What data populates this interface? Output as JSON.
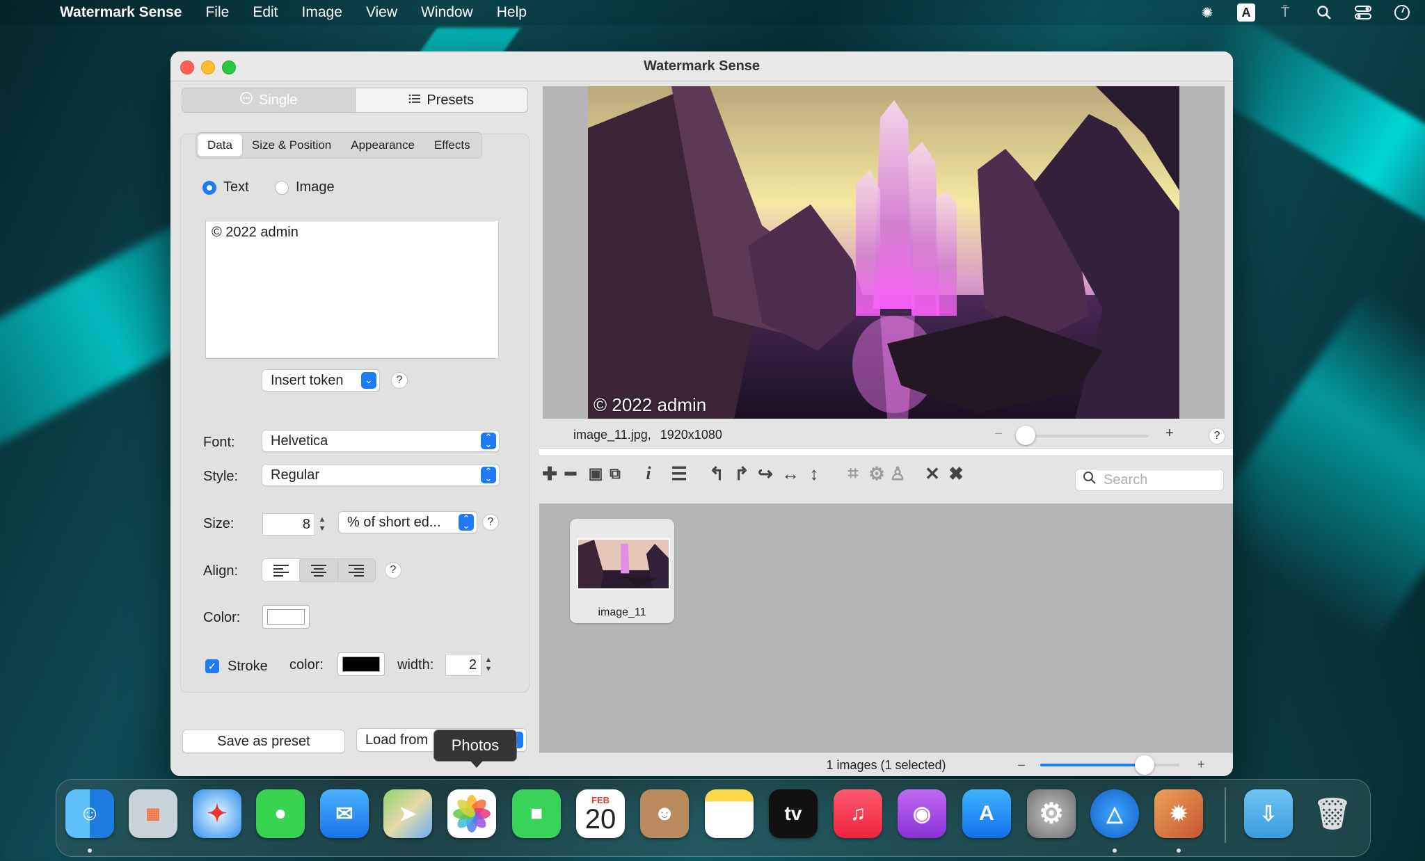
{
  "menubar": {
    "app_name": "Watermark Sense",
    "items": [
      "File",
      "Edit",
      "Image",
      "View",
      "Window",
      "Help"
    ],
    "right_icons": [
      "bug-icon",
      "input-source-icon",
      "antenna-icon",
      "spotlight-search-icon",
      "control-center-icon",
      "clock-icon"
    ],
    "input_source_letter": "A"
  },
  "window": {
    "title": "Watermark Sense",
    "mode_tabs": [
      "Single",
      "Presets"
    ],
    "settings_tabs": [
      "Data",
      "Size & Position",
      "Appearance",
      "Effects"
    ],
    "data_radio": {
      "text": "Text",
      "image": "Image",
      "selected": "Text"
    },
    "watermark_text": "© 2022 admin",
    "insert_token": "Insert token",
    "help": "?",
    "font": {
      "label": "Font:",
      "value": "Helvetica"
    },
    "style": {
      "label": "Style:",
      "value": "Regular"
    },
    "size": {
      "label": "Size:",
      "value": "8",
      "unit": "% of short ed..."
    },
    "align": {
      "label": "Align:",
      "selected": "left"
    },
    "color": {
      "label": "Color:",
      "value": "#ffffff"
    },
    "stroke": {
      "label": "Stroke",
      "checked": true,
      "color_label": "color:",
      "color": "#000000",
      "width_label": "width:",
      "width": "2"
    },
    "save_preset": "Save as preset",
    "load_from": "Load from",
    "tooltip": "Photos"
  },
  "preview": {
    "watermark": "© 2022 admin",
    "filename": "image_11.jpg,",
    "dimensions": "1920x1080",
    "zoom_minus": "–",
    "zoom_plus": "+",
    "zoom_level": 0.0
  },
  "toolbar": {
    "icons": [
      "add-icon",
      "remove-icon",
      "save-icon",
      "save-all-icon",
      "info-icon",
      "list-icon",
      "rotate-left-icon",
      "rotate-right-icon",
      "rotate-icon",
      "flip-horizontal-icon",
      "flip-vertical-icon",
      "crop-icon",
      "crop-settings-icon",
      "clean-icon",
      "close-icon",
      "close-all-icon"
    ],
    "search_placeholder": "Search"
  },
  "browser": {
    "items": [
      {
        "name": "image_11"
      }
    ],
    "status": "1 images (1 selected)",
    "thumb_zoom_minus": "–",
    "thumb_zoom_plus": "+",
    "thumb_zoom_level": 0.75
  },
  "dock": {
    "apps": [
      "Finder",
      "Launchpad",
      "Safari",
      "Messages",
      "Mail",
      "Maps",
      "Photos",
      "FaceTime",
      "Calendar",
      "Contacts",
      "Notes",
      "TV",
      "Music",
      "Podcasts",
      "App Store",
      "System Preferences",
      "Watermark Sense",
      "Stamp"
    ],
    "calendar_month": "FEB",
    "calendar_day": "20",
    "tv_label": "tv"
  }
}
